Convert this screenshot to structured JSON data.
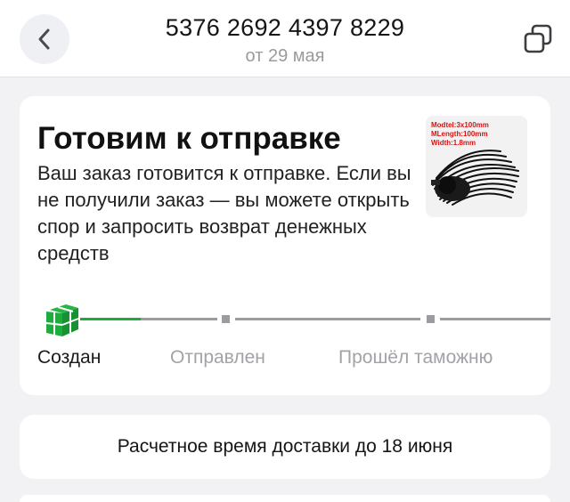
{
  "header": {
    "order_number": "5376 2692 4397 8229",
    "order_date": "от 29 мая",
    "back_icon": "chevron-left-icon",
    "copy_icon": "copy-icon"
  },
  "status": {
    "title": "Готовим к отправке",
    "description": "Ваш заказ готовится к отправке. Если вы не получили заказ — вы можете открыть спор и запросить возврат денежных средств",
    "product_caption": [
      "Modtel:3x100mm",
      "MLength:100mm",
      "Width:1.8mm"
    ],
    "steps": [
      {
        "label": "Создан",
        "state": "done"
      },
      {
        "label": "Отправлен",
        "state": "pending"
      },
      {
        "label": "Прошёл таможню",
        "state": "pending"
      }
    ],
    "colors": {
      "active": "#1faa3c",
      "inactive": "#9b9ba0",
      "inactive_text": "#a2a2a8"
    }
  },
  "delivery": {
    "text": "Расчетное время доставки до 18 июня"
  }
}
